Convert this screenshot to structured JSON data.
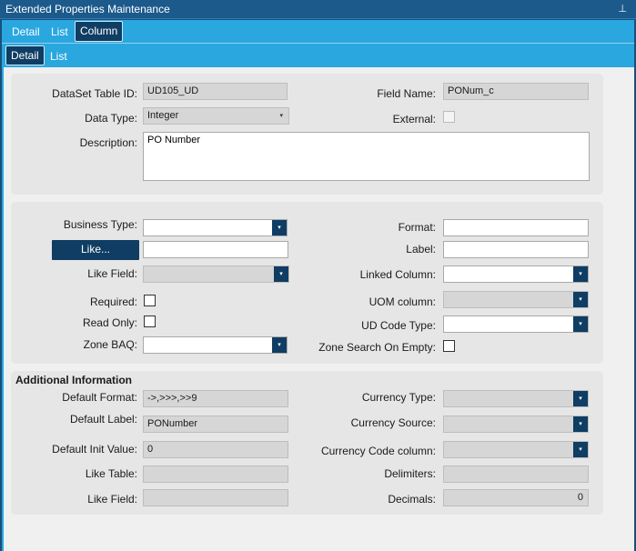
{
  "window": {
    "title": "Extended Properties Maintenance",
    "pin_icon": "pin-icon"
  },
  "outer_tabs": [
    {
      "label": "Detail"
    },
    {
      "label": "List"
    },
    {
      "label": "Column"
    }
  ],
  "inner_tabs": [
    {
      "label": "Detail"
    },
    {
      "label": "List"
    }
  ],
  "general": {
    "dataset_table_id_label": "DataSet Table ID:",
    "dataset_table_id": "UD105_UD",
    "field_name_label": "Field Name:",
    "field_name": "PONum_c",
    "data_type_label": "Data Type:",
    "data_type": "Integer",
    "external_label": "External:",
    "external_checked": false,
    "description_label": "Description:",
    "description": "PO Number"
  },
  "properties": {
    "business_type_label": "Business Type:",
    "business_type": "",
    "format_label": "Format:",
    "format": "",
    "like_button": "Like...",
    "like": "",
    "label_label": "Label:",
    "label": "",
    "like_field_label": "Like Field:",
    "like_field": "",
    "linked_column_label": "Linked Column:",
    "linked_column": "",
    "required_label": "Required:",
    "required_checked": false,
    "uom_column_label": "UOM column:",
    "uom_column": "",
    "read_only_label": "Read Only:",
    "read_only_checked": false,
    "ud_code_type_label": "UD Code Type:",
    "ud_code_type": "",
    "zone_baq_label": "Zone BAQ:",
    "zone_baq": "",
    "zone_search_label": "Zone Search On Empty:",
    "zone_search_checked": false
  },
  "additional": {
    "title": "Additional Information",
    "default_format_label": "Default Format:",
    "default_format": "->,>>>,>>9",
    "currency_type_label": "Currency Type:",
    "currency_type": "",
    "default_label_label": "Default Label:",
    "default_label": "PONumber",
    "currency_source_label": "Currency Source:",
    "currency_source": "",
    "default_init_label": "Default Init Value:",
    "default_init": "0",
    "currency_code_label": "Currency Code column:",
    "currency_code": "",
    "like_table_label": "Like Table:",
    "like_table": "",
    "delimiters_label": "Delimiters:",
    "delimiters": "",
    "like_field_label": "Like Field:",
    "like_field": "",
    "decimals_label": "Decimals:",
    "decimals": "0"
  },
  "icons": {
    "dropdown": "▾"
  },
  "colors": {
    "accent": "#2aa7df",
    "dark_button": "#0f3d63",
    "titlebar": "#1c5a8c"
  }
}
